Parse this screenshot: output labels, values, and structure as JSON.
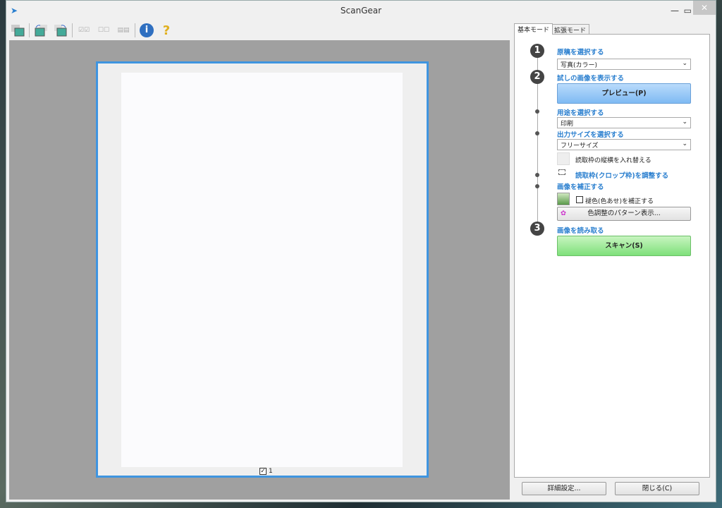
{
  "window": {
    "title": "ScanGear"
  },
  "toolbar": {
    "items": [
      "thumbnail-view",
      "rotate-left",
      "rotate-right",
      "select-all",
      "deselect-all",
      "multi-crop",
      "information",
      "help"
    ]
  },
  "preview": {
    "frame_checkbox_label": "1",
    "frame_checked": true
  },
  "tabs": [
    {
      "label": "基本モード",
      "active": true
    },
    {
      "label": "拡張モード",
      "active": false
    }
  ],
  "steps": {
    "s1": {
      "number": "1",
      "label": "原稿を選択する",
      "select": "写真(カラー)"
    },
    "s2": {
      "number": "2",
      "label": "試しの画像を表示する",
      "button": "プレビュー(P)"
    },
    "purpose": {
      "label": "用途を選択する",
      "select": "印刷"
    },
    "size": {
      "label": "出力サイズを選択する",
      "select": "フリーサイズ",
      "swap": "読取枠の縦横を入れ替える"
    },
    "crop": {
      "label": "読取枠(クロップ枠)を調整する"
    },
    "correct": {
      "label": "画像を補正する",
      "fade": "褪色(色あせ)を補正する",
      "fade_checked": false,
      "pattern": "色調整のパターン表示..."
    },
    "s3": {
      "number": "3",
      "label": "画像を読み取る",
      "button": "スキャン(S)"
    }
  },
  "footer": {
    "prefs": "詳細設定...",
    "close": "閉じる(C)"
  }
}
